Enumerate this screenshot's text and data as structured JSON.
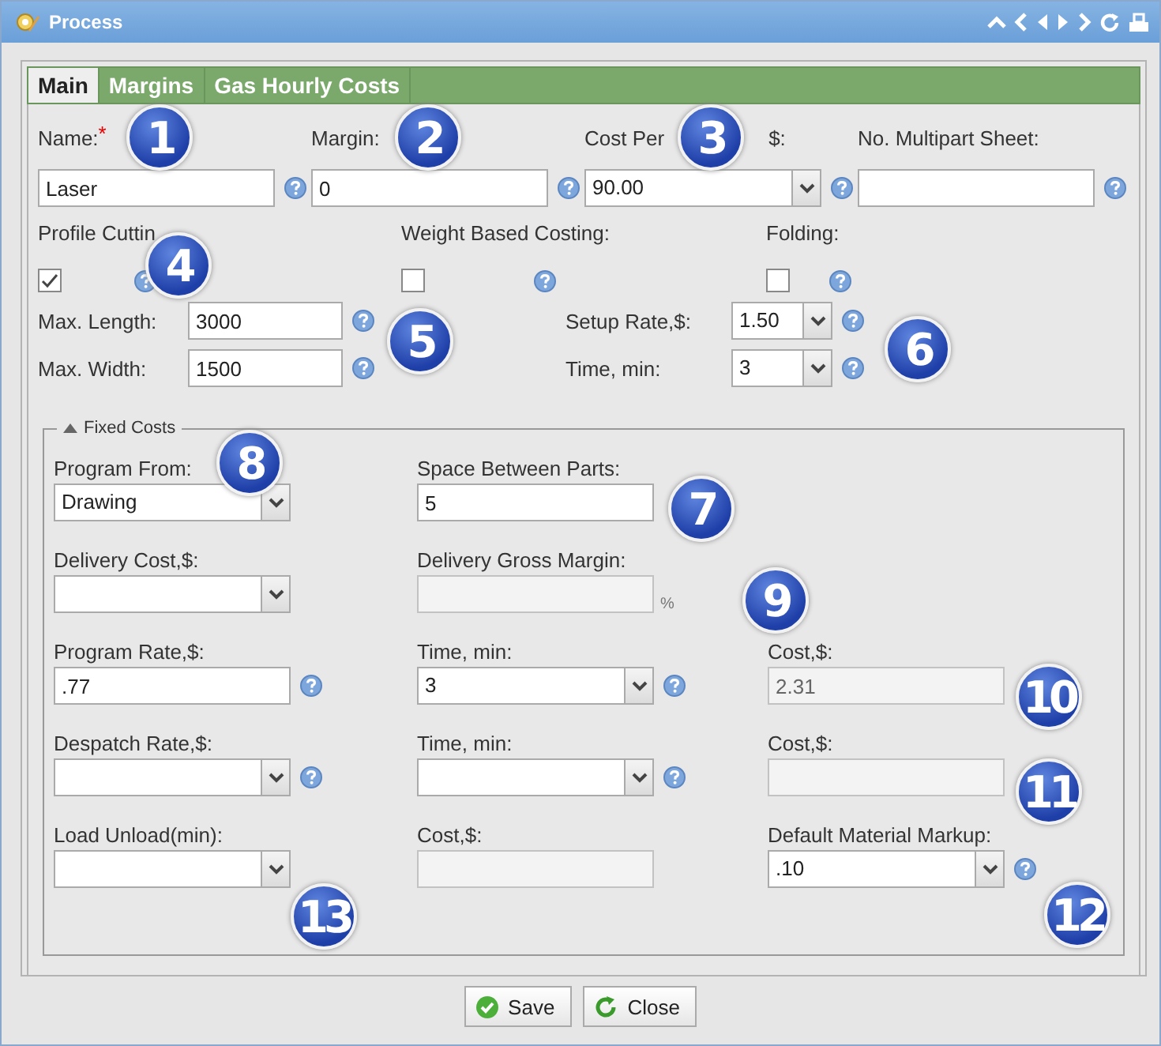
{
  "window": {
    "title": "Process"
  },
  "tabs": [
    {
      "label": "Main",
      "selected": true
    },
    {
      "label": "Margins",
      "selected": false
    },
    {
      "label": "Gas Hourly Costs",
      "selected": false
    }
  ],
  "main_fields": [
    {
      "label": "Name:",
      "required_marker": "*",
      "kind": "text",
      "value": "Laser",
      "help": true
    },
    {
      "label": "Margin:",
      "kind": "text",
      "value": "0",
      "help": true
    },
    {
      "label": "Cost Per",
      "label_tail": "$:",
      "kind": "select",
      "value": "90.00",
      "help": true
    },
    {
      "label": "No. Multipart Sheet:",
      "kind": "text",
      "help": true
    }
  ],
  "toggles": [
    {
      "label": "Profile Cuttin",
      "checked": true,
      "help": true
    },
    {
      "label": "Weight Based Costing:",
      "checked": false,
      "help": true
    },
    {
      "label": "Folding:",
      "checked": false,
      "help": true
    }
  ],
  "sizes": [
    {
      "label": "Max. Length:",
      "kind": "text",
      "value": "3000",
      "help": true
    },
    {
      "label": "Max. Width:",
      "kind": "text",
      "value": "1500",
      "help": true
    }
  ],
  "rates": [
    {
      "label": "Setup Rate,$:",
      "kind": "select",
      "value": "1.50",
      "help": true
    },
    {
      "label": "Time, min:",
      "kind": "select",
      "value": "3",
      "help": true
    }
  ],
  "fixed_costs": {
    "title": "Fixed Costs",
    "expanded": true,
    "rows": [
      [
        {
          "label": "Program From:",
          "kind": "select",
          "value": "Drawing",
          "help": false,
          "disabled": false
        },
        {
          "label": "Space Between Parts:",
          "kind": "text",
          "value": "5",
          "help": false,
          "disabled": false
        }
      ],
      [
        {
          "label": "Delivery Cost,$:",
          "kind": "select",
          "help": false,
          "disabled": false
        },
        {
          "label": "Delivery Gross Margin:",
          "kind": "text",
          "help": false,
          "disabled": true,
          "unit": "%"
        }
      ],
      [
        {
          "label": "Program Rate,$:",
          "kind": "text",
          "value": ".77",
          "help": true,
          "disabled": false
        },
        {
          "label": "Time, min:",
          "kind": "select",
          "value": "3",
          "help": true,
          "disabled": false
        },
        {
          "label": "Cost,$:",
          "kind": "text",
          "value": "2.31",
          "help": false,
          "disabled": true
        }
      ],
      [
        {
          "label": "Despatch Rate,$:",
          "kind": "select",
          "help": true,
          "disabled": false
        },
        {
          "label": "Time, min:",
          "kind": "select",
          "help": true,
          "disabled": false
        },
        {
          "label": "Cost,$:",
          "kind": "text",
          "help": false,
          "disabled": true
        }
      ],
      [
        {
          "label": "Load Unload(min):",
          "kind": "select",
          "help": false,
          "disabled": false
        },
        {
          "label": "Cost,$:",
          "kind": "text",
          "help": false,
          "disabled": true
        },
        {
          "label": "Default Material Markup:",
          "kind": "select",
          "value": ".10",
          "help": true,
          "disabled": false
        }
      ]
    ]
  },
  "buttons": [
    {
      "label": "Save",
      "kind": "save"
    },
    {
      "label": "Close",
      "kind": "close"
    }
  ],
  "callouts": [
    "1",
    "2",
    "3",
    "4",
    "5",
    "6",
    "7",
    "8",
    "9",
    "10",
    "11",
    "12",
    "13"
  ]
}
